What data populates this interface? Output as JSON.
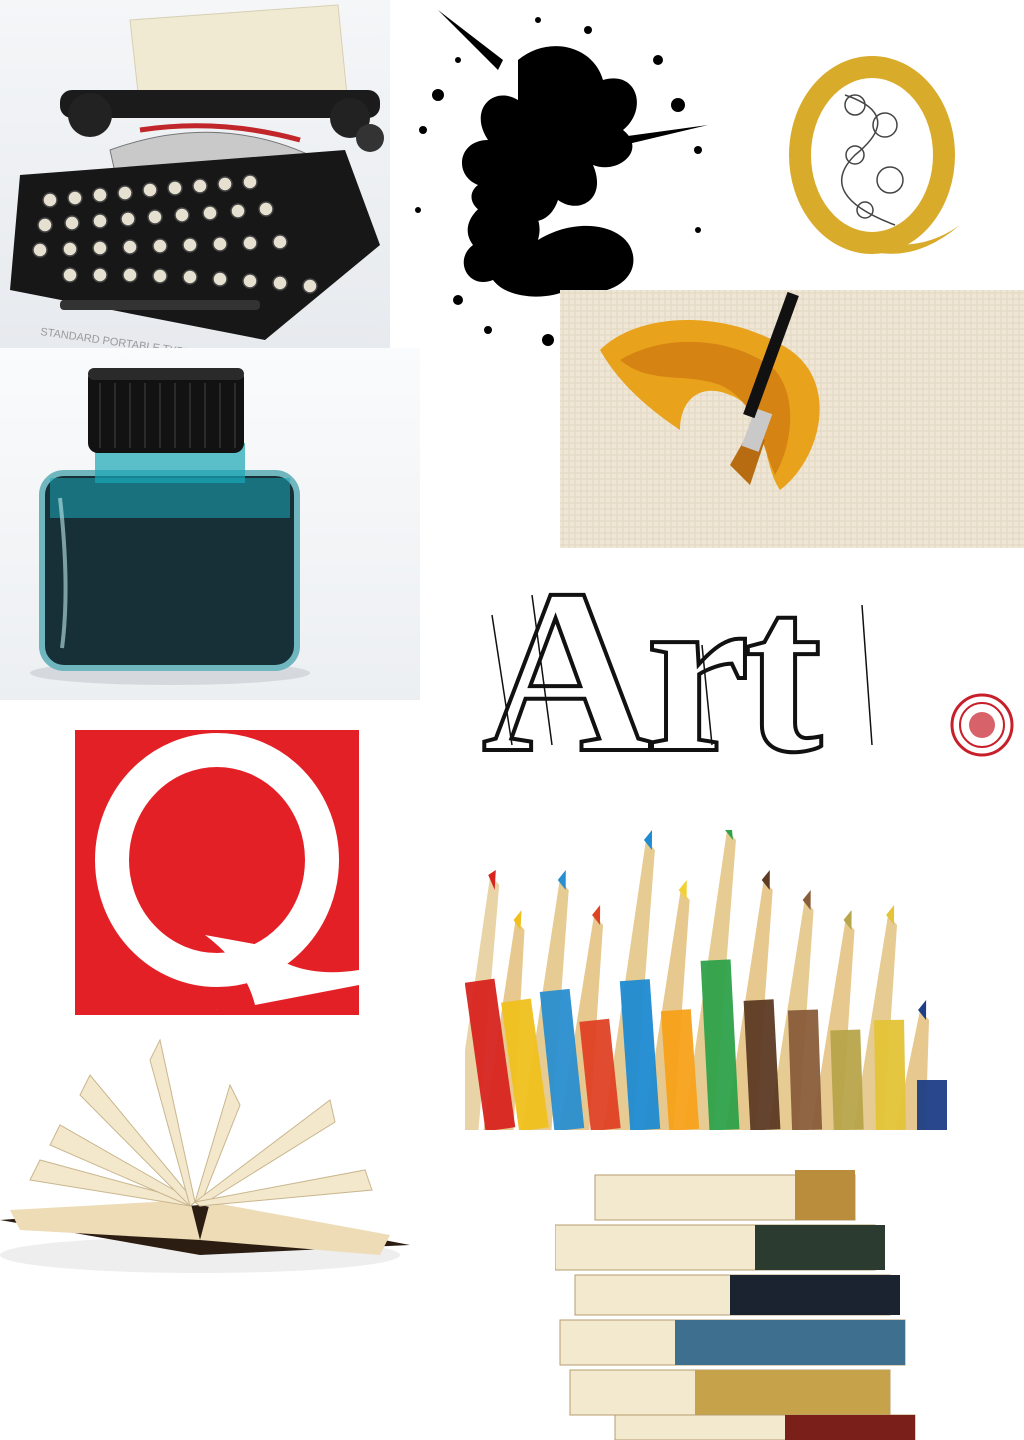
{
  "collage": {
    "typewriter": {
      "icon": "typewriter-icon",
      "brand_text": "STANDARD PORTABLE TYPEWRITER"
    },
    "ink_splat": {
      "icon": "ink-splat-icon"
    },
    "gold_q": {
      "letter": "Q",
      "color": "#d9ab2b"
    },
    "paint_brush": {
      "icon": "paintbrush-icon",
      "paint_color": "#e59a17"
    },
    "ink_bottle": {
      "icon": "ink-bottle-icon",
      "ink_color": "#1aa7b7"
    },
    "art_logo": {
      "text": "Art",
      "dot_color": "#c8202a"
    },
    "red_q": {
      "letter": "Q",
      "background": "#e42027"
    },
    "colored_pencils": {
      "icon": "colored-pencils-icon"
    },
    "open_book": {
      "icon": "open-book-icon"
    },
    "book_stack": {
      "icon": "book-stack-icon"
    }
  }
}
